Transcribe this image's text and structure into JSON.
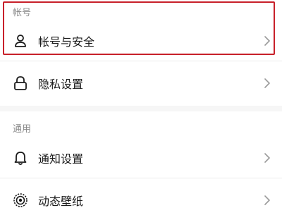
{
  "sections": {
    "account": {
      "header": "帐号",
      "items": [
        {
          "label": "帐号与安全",
          "icon": "person-icon"
        }
      ]
    },
    "privacy": {
      "items": [
        {
          "label": "隐私设置",
          "icon": "lock-icon"
        }
      ]
    },
    "general": {
      "header": "通用",
      "items": [
        {
          "label": "通知设置",
          "icon": "bell-icon"
        },
        {
          "label": "动态壁纸",
          "icon": "live-wallpaper-icon"
        }
      ]
    }
  },
  "colors": {
    "highlight_border": "#c8202a",
    "section_header": "#8a8a8a",
    "chevron": "#9a9a9a"
  }
}
